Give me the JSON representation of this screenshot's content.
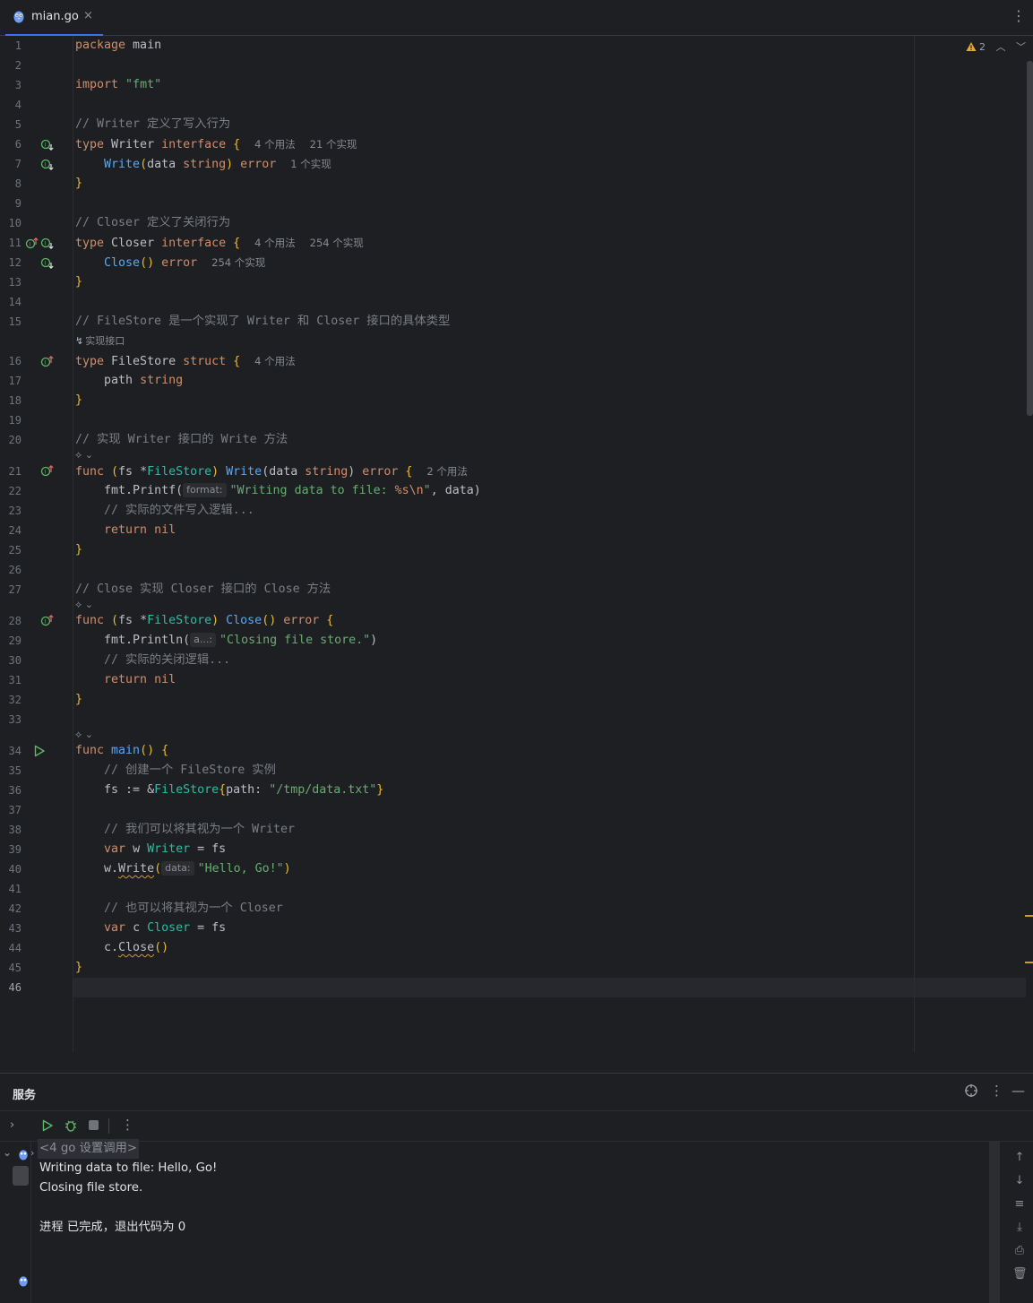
{
  "tab": {
    "title": "mian.go",
    "close": "×",
    "more": "⋮"
  },
  "inspections": {
    "count": "2"
  },
  "lines": [
    {
      "n": "1"
    },
    {
      "n": "2"
    },
    {
      "n": "3"
    },
    {
      "n": "4"
    },
    {
      "n": "5"
    },
    {
      "n": "6"
    },
    {
      "n": "7"
    },
    {
      "n": "8"
    },
    {
      "n": "9"
    },
    {
      "n": "10"
    },
    {
      "n": "11"
    },
    {
      "n": "12"
    },
    {
      "n": "13"
    },
    {
      "n": "14"
    },
    {
      "n": "15"
    },
    {
      "n": "16"
    },
    {
      "n": "17"
    },
    {
      "n": "18"
    },
    {
      "n": "19"
    },
    {
      "n": "20"
    },
    {
      "n": "21"
    },
    {
      "n": "22"
    },
    {
      "n": "23"
    },
    {
      "n": "24"
    },
    {
      "n": "25"
    },
    {
      "n": "26"
    },
    {
      "n": "27"
    },
    {
      "n": "28"
    },
    {
      "n": "29"
    },
    {
      "n": "30"
    },
    {
      "n": "31"
    },
    {
      "n": "32"
    },
    {
      "n": "33"
    },
    {
      "n": "34"
    },
    {
      "n": "35"
    },
    {
      "n": "36"
    },
    {
      "n": "37"
    },
    {
      "n": "38"
    },
    {
      "n": "39"
    },
    {
      "n": "40"
    },
    {
      "n": "41"
    },
    {
      "n": "42"
    },
    {
      "n": "43"
    },
    {
      "n": "44"
    },
    {
      "n": "45"
    },
    {
      "n": "46"
    }
  ],
  "code": {
    "l1_kw": "package",
    "l1_id": " main",
    "l3_kw": "import",
    "l3_str": " \"fmt\"",
    "l5": "// Writer 定义了写入行为",
    "l6_kw": "type",
    "l6_name": " Writer ",
    "l6_kw2": "interface",
    "l6_br": " {",
    "l6_hint1": "4 个用法",
    "l6_hint2": "21 个实现",
    "l7_fn": "Write",
    "l7_p": "(",
    "l7_arg": "data ",
    "l7_ty": "string",
    "l7_p2": ") ",
    "l7_ret": "error",
    "l7_hint": "1 个实现",
    "l8": "}",
    "l10": "// Closer 定义了关闭行为",
    "l11_kw": "type",
    "l11_name": " Closer ",
    "l11_kw2": "interface",
    "l11_br": " {",
    "l11_hint1": "4 个用法",
    "l11_hint2": "254 个实现",
    "l12_fn": "Close",
    "l12_p": "() ",
    "l12_ret": "error",
    "l12_hint": "254 个实现",
    "l13": "}",
    "l15": "// FileStore 是一个实现了 Writer 和 Closer 接口的具体类型",
    "l15_lens": "实现接口",
    "l16_kw": "type",
    "l16_name": " FileStore ",
    "l16_kw2": "struct",
    "l16_br": " {",
    "l16_hint": "4 个用法",
    "l17_field": "path ",
    "l17_ty": "string",
    "l18": "}",
    "l20": "// 实现 Writer 接口的 Write 方法",
    "l21_kw": "func",
    "l21_a": " (",
    "l21_recv": "fs",
    "l21_b": " *",
    "l21_ty": "FileStore",
    "l21_c": ") ",
    "l21_fn": "Write",
    "l21_d": "(data ",
    "l21_ty2": "string",
    "l21_e": ") ",
    "l21_ret": "error",
    "l21_br": " {",
    "l21_hint": "2 个用法",
    "l22_a": "fmt.Printf(",
    "l22_inlay": "format:",
    "l22_str1": "\"Writing data to file: ",
    "l22_esc": "%s\\n",
    "l22_str2": "\"",
    "l22_b": ", data)",
    "l23": "// 实际的文件写入逻辑...",
    "l24_kw": "return",
    "l24_nil": " nil",
    "l25": "}",
    "l27": "// Close 实现 Closer 接口的 Close 方法",
    "l28_kw": "func",
    "l28_a": " (",
    "l28_recv": "fs",
    "l28_b": " *",
    "l28_ty": "FileStore",
    "l28_c": ") ",
    "l28_fn": "Close",
    "l28_d": "() ",
    "l28_ret": "error",
    "l28_br": " {",
    "l29_a": "fmt.Println(",
    "l29_inlay": "a...:",
    "l29_str": "\"Closing file store.\"",
    "l29_b": ")",
    "l30": "// 实际的关闭逻辑...",
    "l31_kw": "return",
    "l31_nil": " nil",
    "l32": "}",
    "l34_kw": "func",
    "l34_fn": " main",
    "l34_p": "()",
    "l34_br": " {",
    "l35": "// 创建一个 FileStore 实例",
    "l36_a": "fs := &",
    "l36_ty": "FileStore",
    "l36_b": "{",
    "l36_f": "path: ",
    "l36_str": "\"/tmp/data.txt\"",
    "l36_c": "}",
    "l38": "// 我们可以将其视为一个 Writer",
    "l39_kw": "var",
    "l39_a": " w ",
    "l39_ty": "Writer",
    "l39_b": " = fs",
    "l40_a": "w.",
    "l40_fn": "Write",
    "l40_p": "(",
    "l40_inlay": "data:",
    "l40_str": "\"Hello, Go!\"",
    "l40_b": ")",
    "l42": "// 也可以将其视为一个 Closer",
    "l43_kw": "var",
    "l43_a": " c ",
    "l43_ty": "Closer",
    "l43_b": " = fs",
    "l44_a": "c.",
    "l44_fn": "Close",
    "l44_p": "()",
    "l45": "}"
  },
  "services": {
    "title": "服务",
    "tree_node": "<4 go 设置调用>",
    "console": [
      "Writing data to file: Hello, Go!",
      "Closing file store.",
      "",
      "进程 已完成，退出代码为 0"
    ]
  },
  "colors": {
    "accent": "#3574f0",
    "run_green": "#5fb865",
    "warning": "#e5a838"
  }
}
